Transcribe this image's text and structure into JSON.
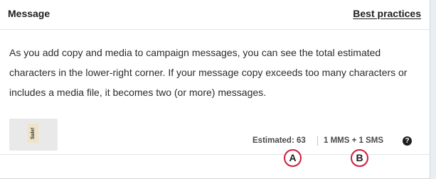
{
  "header": {
    "title": "Message",
    "link": "Best practices"
  },
  "body": {
    "text": "As you add copy and media to campaign messages, you can see the total estimated characters in the lower-right corner. If your message copy exceeds too many characters or includes a media file, it becomes two (or more) messages."
  },
  "media": {
    "label": "Sale!"
  },
  "footer": {
    "estimated": "Estimated: 63",
    "message_count": "1 MMS + 1 SMS",
    "help_icon": "question-circle-icon"
  },
  "callouts": {
    "a": "A",
    "b": "B",
    "color": "#d01c3c"
  }
}
